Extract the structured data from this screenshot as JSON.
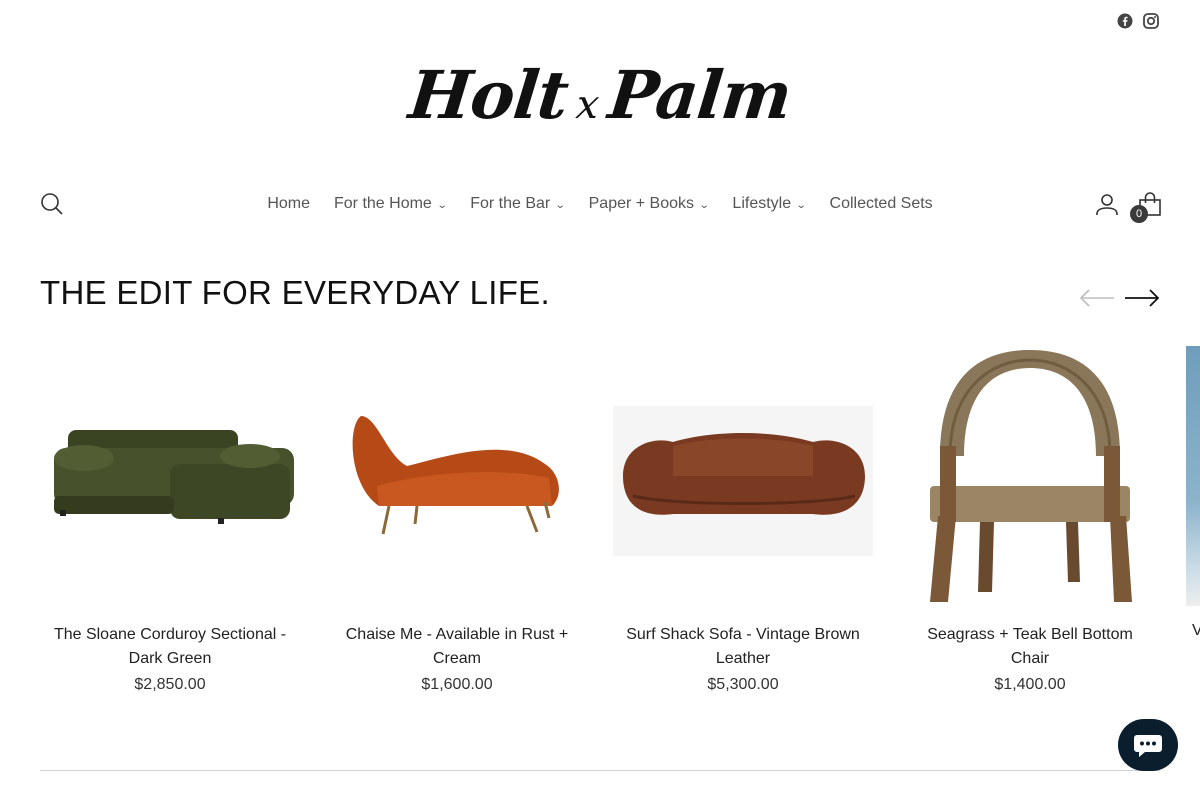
{
  "social": {
    "facebook_icon": "facebook-icon",
    "instagram_icon": "instagram-icon"
  },
  "logo": {
    "part1": "Holt",
    "sep": "x",
    "part2": "Palm"
  },
  "nav": {
    "items": [
      {
        "label": "Home",
        "has_dropdown": false
      },
      {
        "label": "For the Home",
        "has_dropdown": true
      },
      {
        "label": "For the Bar",
        "has_dropdown": true
      },
      {
        "label": "Paper + Books",
        "has_dropdown": true
      },
      {
        "label": "Lifestyle",
        "has_dropdown": true
      },
      {
        "label": "Collected Sets",
        "has_dropdown": false
      }
    ],
    "chevron": "⌄",
    "cart_count": "0"
  },
  "section": {
    "title": "THE EDIT FOR EVERYDAY LIFE."
  },
  "products": [
    {
      "name": "The Sloane Corduroy Sectional - Dark Green",
      "price": "$2,850.00"
    },
    {
      "name": "Chaise Me - Available in Rust + Cream",
      "price": "$1,600.00"
    },
    {
      "name": "Surf Shack Sofa - Vintage Brown Leather",
      "price": "$5,300.00"
    },
    {
      "name": "Seagrass + Teak Bell Bottom Chair",
      "price": "$1,400.00"
    }
  ],
  "partial_product": {
    "name_start": "V"
  },
  "colors": {
    "chat_bg": "#0b1e2d",
    "text": "#1a1a1a",
    "nav_text": "#555555"
  }
}
